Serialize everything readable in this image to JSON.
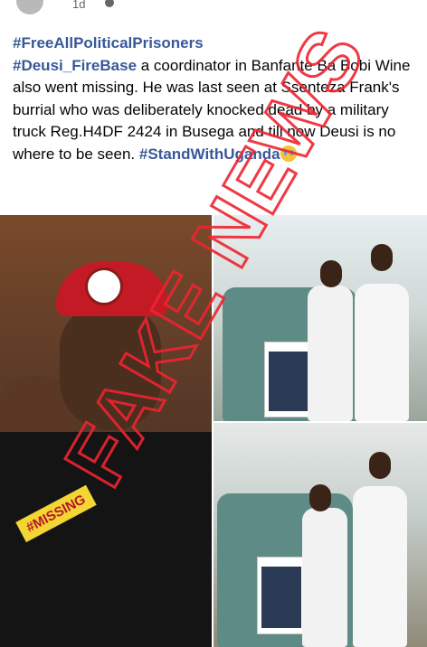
{
  "post_header": {
    "time": "1d"
  },
  "post": {
    "tag1": "#FreeAllPoliticalPrisoners",
    "tag2": "#Deusi_FireBase",
    "body1": " a coordinator in Banfante Ba Bobi Wine also went missing. He was last seen at Ssenteza Frank's burrial who was deliberately knocked dead by a military truck Reg.H4DF 2424 in Busega and till now Deusi is no where to be seen. ",
    "tag3": "#StandWithUganda"
  },
  "watermark": {
    "text": "FAKE NEWS",
    "color": "#ef2430"
  },
  "photo_left": {
    "sticker": "#MISSING"
  },
  "colors": {
    "link": "#385898",
    "text": "#050505",
    "meta": "#65676b"
  }
}
